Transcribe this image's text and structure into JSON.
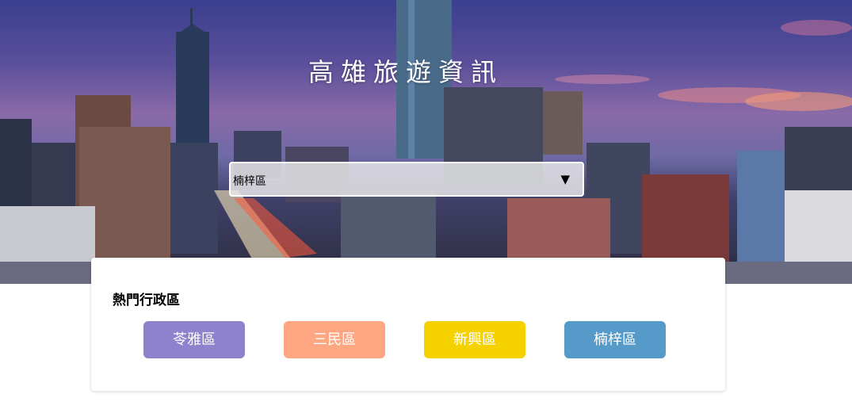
{
  "header": {
    "title": "高雄旅遊資訊"
  },
  "district_select": {
    "selected": "楠梓區",
    "arrow_icon": "triangle-down-icon"
  },
  "popular": {
    "heading": "熱門行政區",
    "buttons": [
      {
        "label": "苓雅區",
        "color": "#8e82cc"
      },
      {
        "label": "三民區",
        "color": "#ffa782"
      },
      {
        "label": "新興區",
        "color": "#f5d100"
      },
      {
        "label": "楠梓區",
        "color": "#559ac8"
      }
    ]
  }
}
